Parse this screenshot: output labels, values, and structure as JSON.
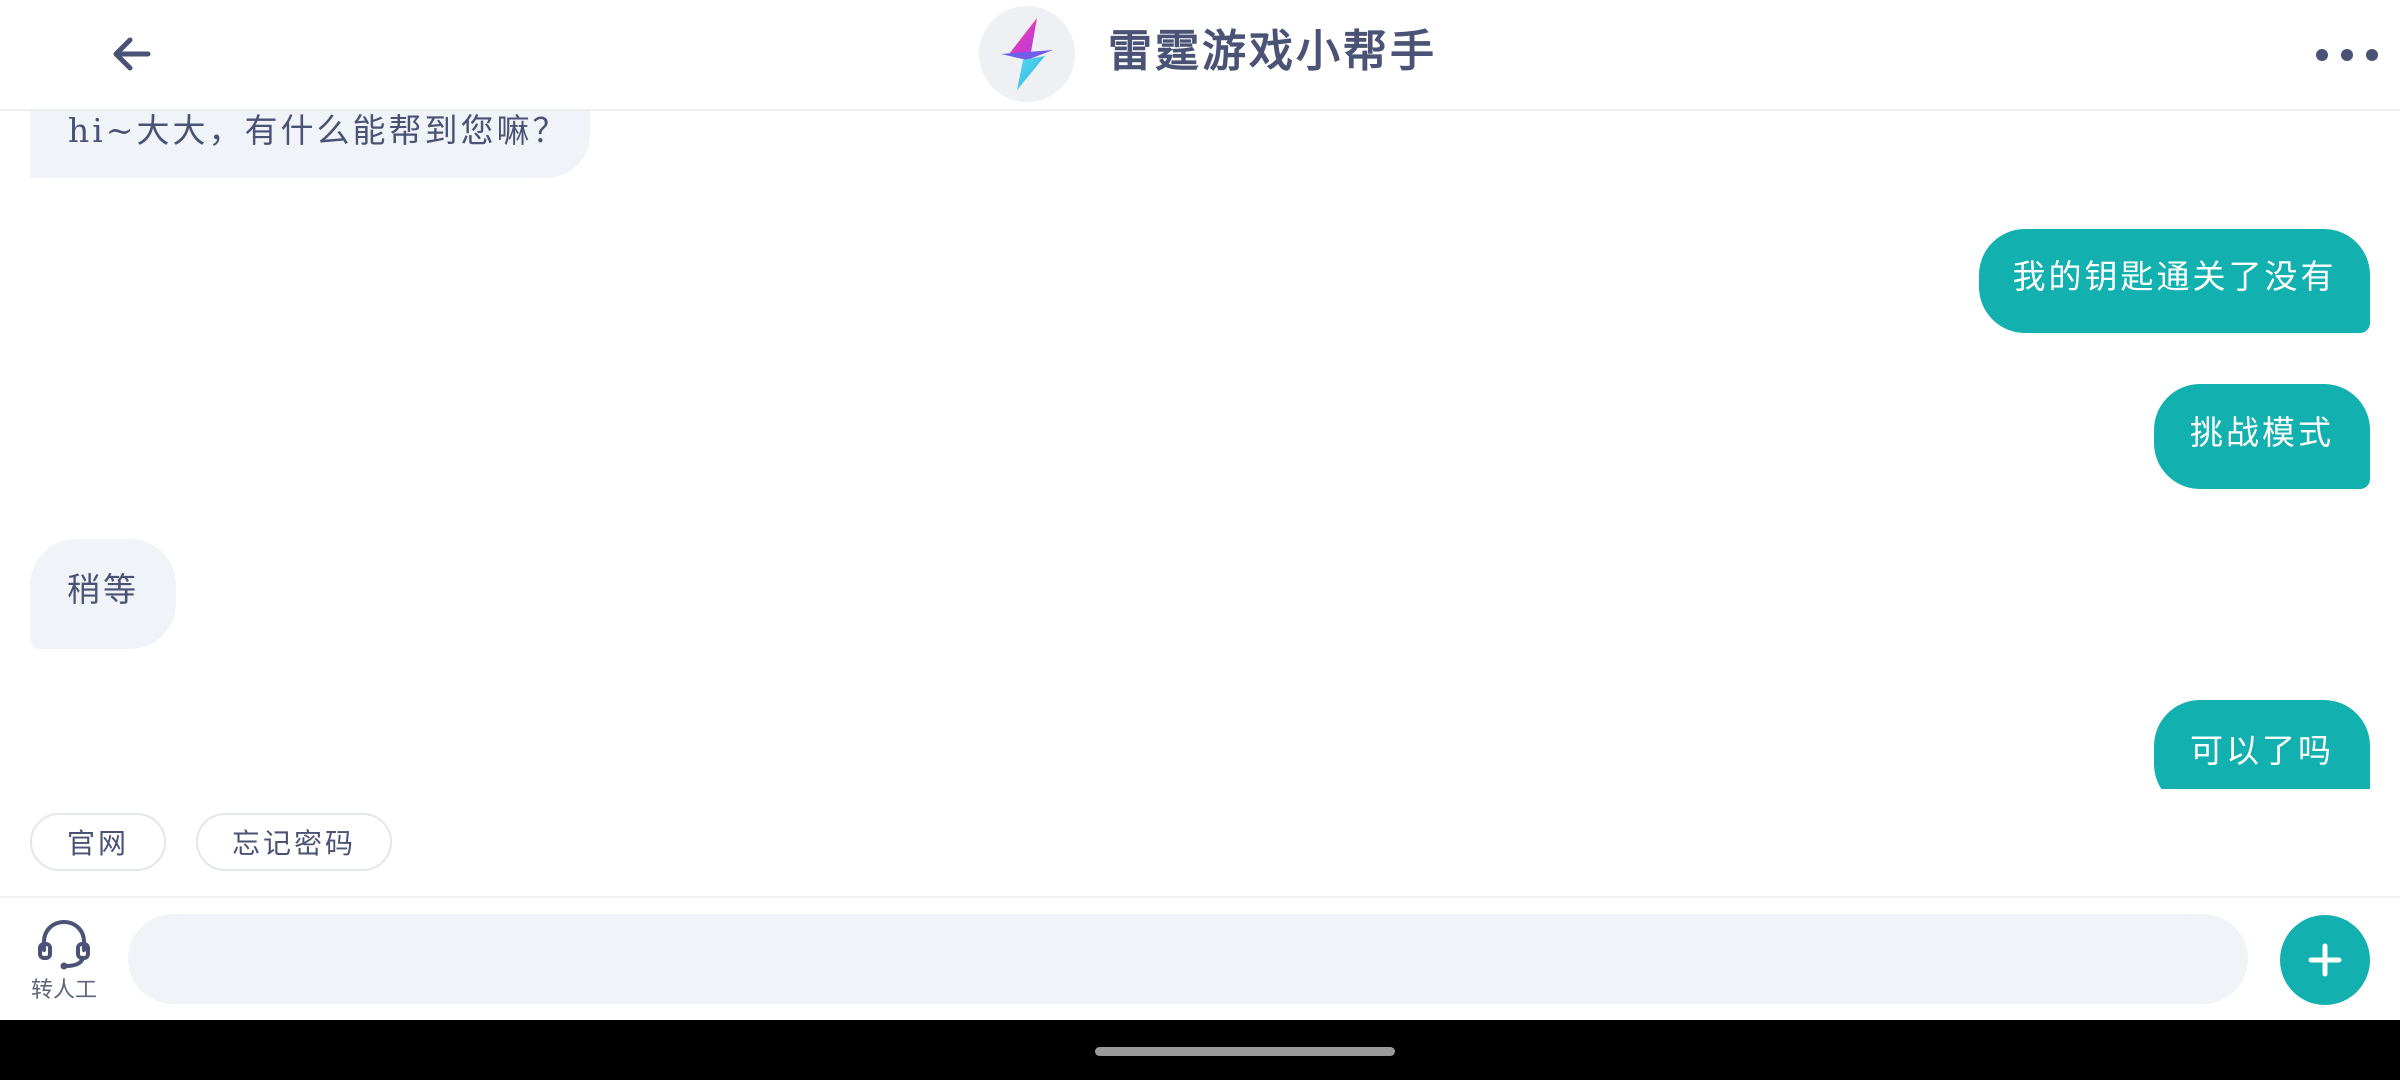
{
  "header": {
    "back_icon": "arrow-left-icon",
    "avatar_icon": "lightning-bolt-logo",
    "title": "雷霆游戏小帮手",
    "more_icon": "more-horizontal-icon"
  },
  "messages": [
    {
      "sender": "bot",
      "text": "hi~大大，有什么能帮到您嘛？"
    },
    {
      "sender": "user",
      "text": "我的钥匙通关了没有"
    },
    {
      "sender": "user",
      "text": "挑战模式"
    },
    {
      "sender": "bot",
      "text": "稍等"
    },
    {
      "sender": "user",
      "text": "可以了吗"
    }
  ],
  "quick_replies": [
    {
      "label": "官网"
    },
    {
      "label": "忘记密码"
    }
  ],
  "input_bar": {
    "agent_icon": "headset-icon",
    "agent_label": "转人工",
    "input_value": "",
    "plus_icon": "plus-icon"
  },
  "colors": {
    "accent": "#13b0b0",
    "bot_bubble": "#f0f3f7",
    "text": "#4a5275",
    "nav_bar": "#000000"
  }
}
